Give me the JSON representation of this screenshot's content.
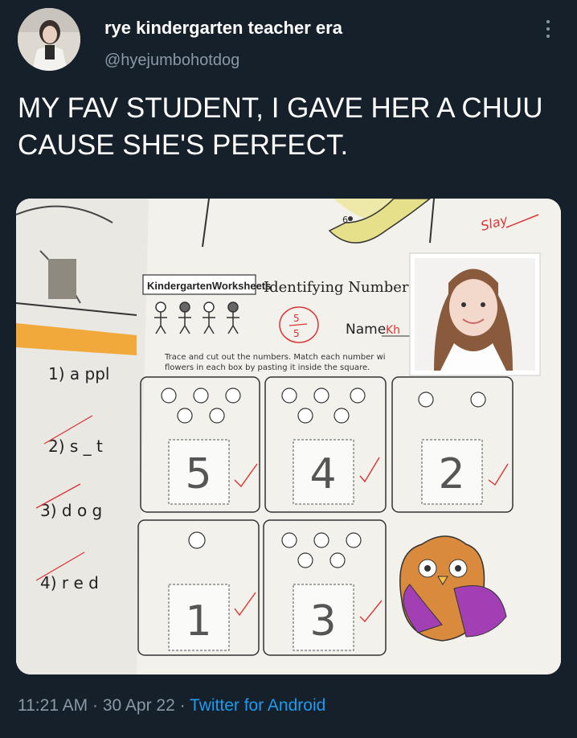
{
  "user": {
    "display_name": "rye kindergarten teacher era",
    "handle": "@hyejumbohotdog"
  },
  "tweet": {
    "text": "MY FAV STUDENT, I GAVE HER A CHUU CAUSE SHE'S PERFECT."
  },
  "worksheet": {
    "brand": "KindergartenWorksheets",
    "title": "Identifying Numbers W",
    "name_label": "Name",
    "name_value": "Kh",
    "score_top": "5",
    "score_bottom": "5",
    "instructions_line1": "Trace and cut out the numbers. Match each number wi",
    "instructions_line2": "flowers in each box by pasting it inside the square.",
    "slay_note": "Slay",
    "top_number": "6",
    "numbers": [
      "5",
      "4",
      "2",
      "1",
      "3"
    ],
    "left_items": [
      "1) a ppl",
      "2) s _ t",
      "3) d o g",
      "4) r e d"
    ]
  },
  "footer": {
    "time": "11:21 AM",
    "sep1": " · ",
    "date": "30 Apr 22",
    "sep2": " · ",
    "source": "Twitter for Android"
  }
}
